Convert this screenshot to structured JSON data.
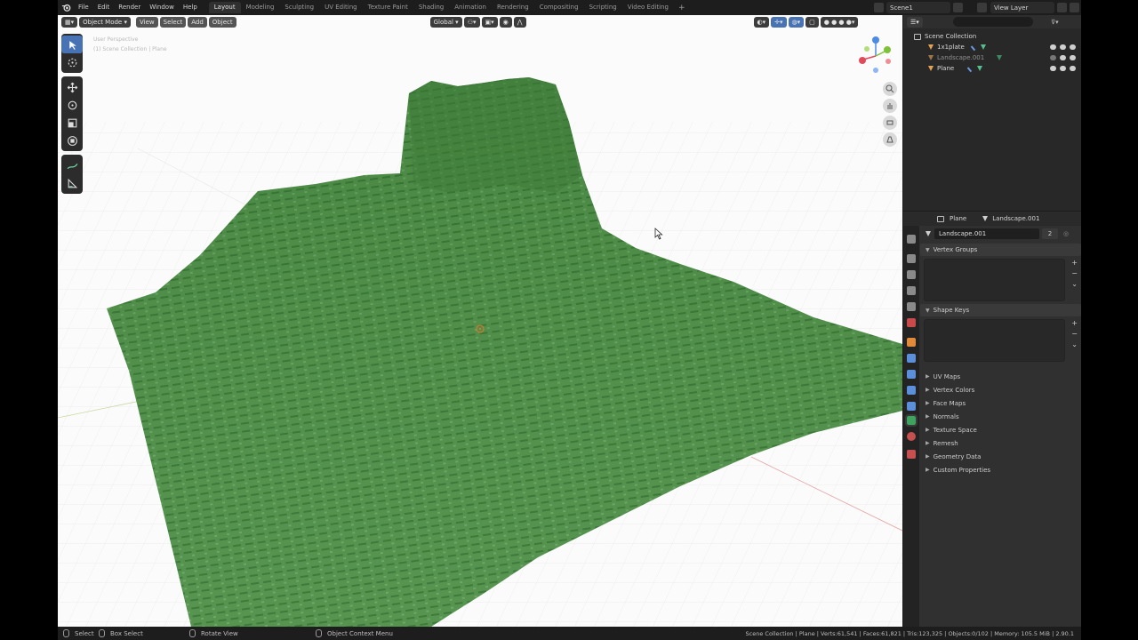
{
  "topbar": {
    "menu": [
      "File",
      "Edit",
      "Render",
      "Window",
      "Help"
    ],
    "workspaces": [
      "Layout",
      "Modeling",
      "Sculpting",
      "UV Editing",
      "Texture Paint",
      "Shading",
      "Animation",
      "Rendering",
      "Compositing",
      "Scripting",
      "Video Editing"
    ],
    "active_workspace": "Layout",
    "add_tab": "+",
    "scene": "Scene1",
    "view_layer": "View Layer"
  },
  "viewport": {
    "mode": "Object Mode",
    "menus": [
      "View",
      "Select",
      "Add",
      "Object"
    ],
    "orientation": "Global",
    "info_line1": "User Perspective",
    "info_line2": "(1) Scene Collection | Plane",
    "terrain_color": "#4a8a45",
    "accent": "#4772b3"
  },
  "outliner": {
    "root": "Scene Collection",
    "items": [
      {
        "name": "1x1plate",
        "dim": false
      },
      {
        "name": "Landscape.001",
        "dim": true
      },
      {
        "name": "Plane",
        "dim": false
      }
    ]
  },
  "properties": {
    "breadcrumb_object": "Plane",
    "breadcrumb_data": "Landscape.001",
    "mesh_name": "Landscape.001",
    "users": "2",
    "vertex_groups": "Vertex Groups",
    "shape_keys": "Shape Keys",
    "panels": [
      "UV Maps",
      "Vertex Colors",
      "Face Maps",
      "Normals",
      "Texture Space",
      "Remesh",
      "Geometry Data",
      "Custom Properties"
    ]
  },
  "statusbar": {
    "select": "Select",
    "box_select": "Box Select",
    "rotate_view": "Rotate View",
    "context_menu": "Object Context Menu",
    "stats": "Scene Collection | Plane | Verts:61,541 | Faces:61,821 | Tris:123,325 | Objects:0/102 | Memory: 105.5 MiB | 2.90.1"
  }
}
